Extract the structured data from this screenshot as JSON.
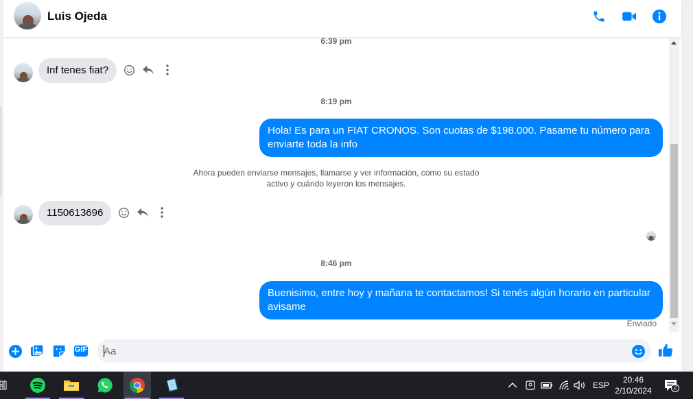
{
  "header": {
    "contact_name": "Luis Ojeda",
    "icons": [
      "phone-icon",
      "video-call-icon",
      "info-icon"
    ],
    "accent": "#0084ff"
  },
  "messages": {
    "time1": "6:39 pm",
    "msg1": "Inf tenes fiat?",
    "time2": "8:19 pm",
    "msg2": "Hola! Es para un FIAT CRONOS. Son cuotas de $198.000. Pasame tu número para enviarte toda la info",
    "system_note_line1": "Ahora pueden enviarse mensajes, llamarse y ver información, como su estado",
    "system_note_line2": "activo y cuándo leyeron los mensajes.",
    "msg3": "1150613696",
    "time3": "8:46 pm",
    "msg4": "Buenisimo, entre hoy y mañana te contactamos! Si tenés algún horario en particular avisame",
    "status": "Enviado"
  },
  "composer": {
    "placeholder": "Aa",
    "gif_label": "GIF",
    "icons": [
      "plus-icon",
      "photo-icon",
      "sticker-icon",
      "gif-icon",
      "emoji-icon",
      "like-icon"
    ]
  },
  "taskbar": {
    "apps": [
      "spotify-icon",
      "file-explorer-icon",
      "whatsapp-icon",
      "chrome-icon",
      "notepad-icon"
    ],
    "language": "ESP",
    "time": "20:46",
    "date": "2/10/2024",
    "notification_count": "2"
  }
}
